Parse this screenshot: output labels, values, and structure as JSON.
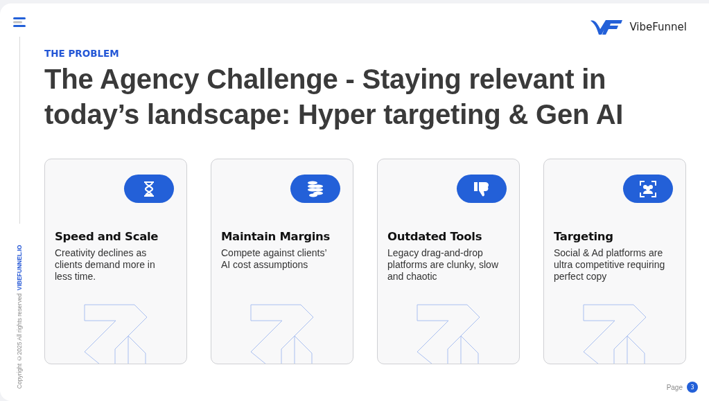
{
  "brand": {
    "name": "VibeFunnel"
  },
  "eyebrow": "THE PROBLEM",
  "title": "The Agency Challenge - Staying relevant in today’s landscape: Hyper targeting & Gen AI",
  "cards": [
    {
      "kind": "hourglass",
      "title": "Speed and Scale",
      "text": "Creativity declines  as clients demand more in less time."
    },
    {
      "kind": "coins",
      "title": "Maintain Margins",
      "text": "Compete against clients’ AI cost assumptions"
    },
    {
      "kind": "thumbs-down",
      "title": "Outdated Tools",
      "text": "Legacy drag-and-drop platforms are clunky, slow and chaotic"
    },
    {
      "kind": "audience",
      "title": "Targeting",
      "text": "Social & Ad platforms are ultra competitive requiring perfect copy"
    }
  ],
  "footer": {
    "copyright": "Copyright ©2025 All rights reserved",
    "site": "VIBEFUNNEL.IO",
    "page_label": "Page",
    "page_number": "3"
  }
}
